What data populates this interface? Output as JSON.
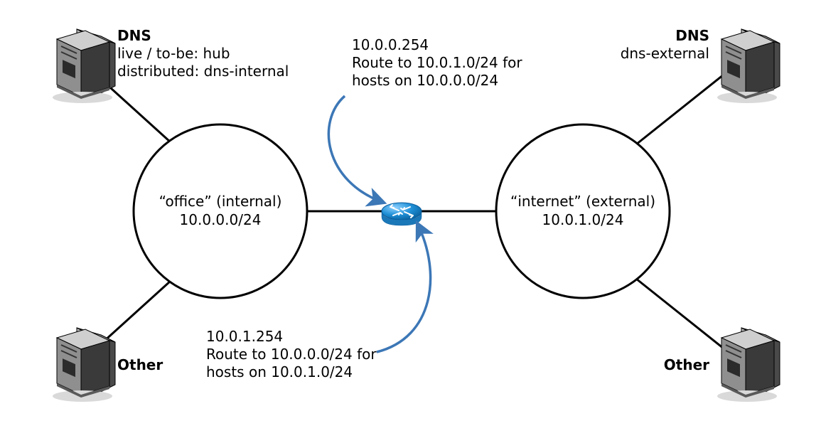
{
  "left_server_top": {
    "title": "DNS",
    "line1": "live / to-be: hub",
    "line2": "distributed: dns-internal"
  },
  "left_server_bottom": {
    "title": "Other"
  },
  "right_server_top": {
    "title": "DNS",
    "line1": "dns-external"
  },
  "right_server_bottom": {
    "title": "Other"
  },
  "office_network": {
    "name": "“office” (internal)",
    "subnet": "10.0.0.0/24"
  },
  "internet_network": {
    "name": "“internet” (external)",
    "subnet": "10.0.1.0/24"
  },
  "route_top": {
    "ip": "10.0.0.254",
    "line1": "Route to 10.0.1.0/24 for",
    "line2": "hosts on 10.0.0.0/24"
  },
  "route_bottom": {
    "ip": "10.0.1.254",
    "line1": "Route to 10.0.0.0/24 for",
    "line2": "hosts on 10.0.1.0/24"
  }
}
